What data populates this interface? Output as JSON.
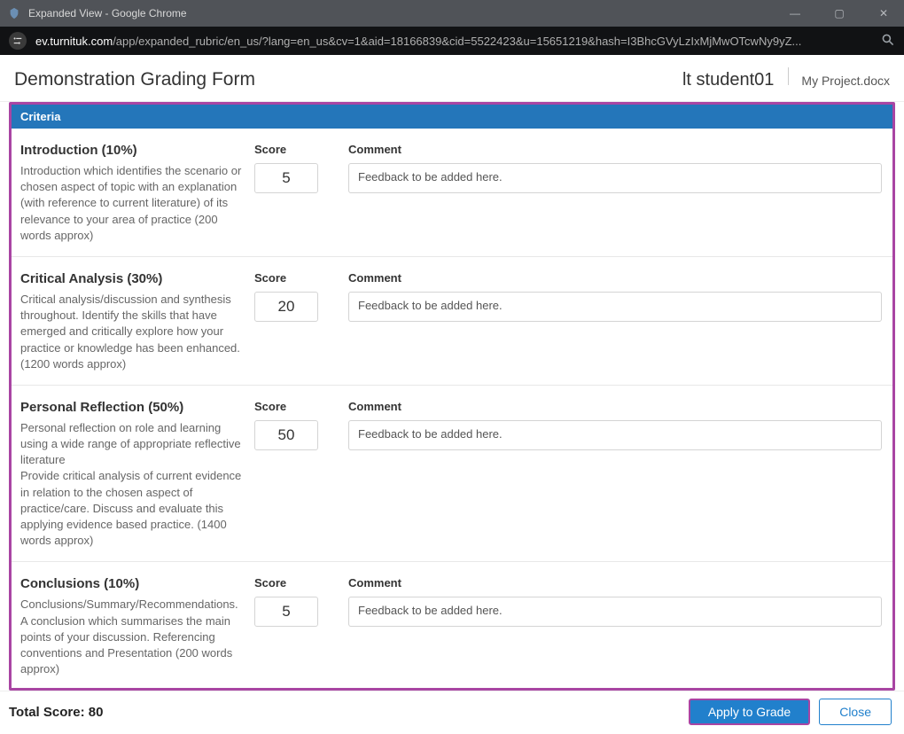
{
  "window": {
    "title": "Expanded View - Google Chrome"
  },
  "url": {
    "domain": "ev.turnituk.com",
    "path": "/app/expanded_rubric/en_us/?lang=en_us&cv=1&aid=18166839&cid=5522423&u=15651219&hash=I3BhcGVyLzIxMjMwOTcwNy9yZ..."
  },
  "header": {
    "title": "Demonstration Grading Form",
    "student": "lt student01",
    "filename": "My Project.docx"
  },
  "criteria_header": "Criteria",
  "column_labels": {
    "score": "Score",
    "comment": "Comment"
  },
  "criteria": [
    {
      "title": "Introduction (10%)",
      "description": "Introduction which identifies the scenario or chosen aspect of topic with an explanation (with reference to current literature) of its relevance to your area of practice (200 words approx)",
      "score": "5",
      "comment": "Feedback to be added here."
    },
    {
      "title": "Critical Analysis (30%)",
      "description": "Critical analysis/discussion and synthesis throughout. Identify the skills that have emerged and critically explore how your practice or knowledge has been enhanced. (1200 words approx)",
      "score": "20",
      "comment": "Feedback to be added here."
    },
    {
      "title": "Personal Reflection (50%)",
      "description": "Personal reflection on role and learning using a wide range of appropriate reflective literature\nProvide critical analysis of current evidence in relation to the chosen aspect of practice/care. Discuss and evaluate this applying evidence based practice. (1400 words approx)",
      "score": "50",
      "comment": "Feedback to be added here."
    },
    {
      "title": "Conclusions (10%)",
      "description": "Conclusions/Summary/Recommendations. A conclusion which summarises the main points of your discussion. Referencing conventions and Presentation (200 words approx)",
      "score": "5",
      "comment": "Feedback to be added here."
    }
  ],
  "footer": {
    "total_label": "Total Score: 80",
    "apply_label": "Apply to Grade",
    "close_label": "Close"
  }
}
